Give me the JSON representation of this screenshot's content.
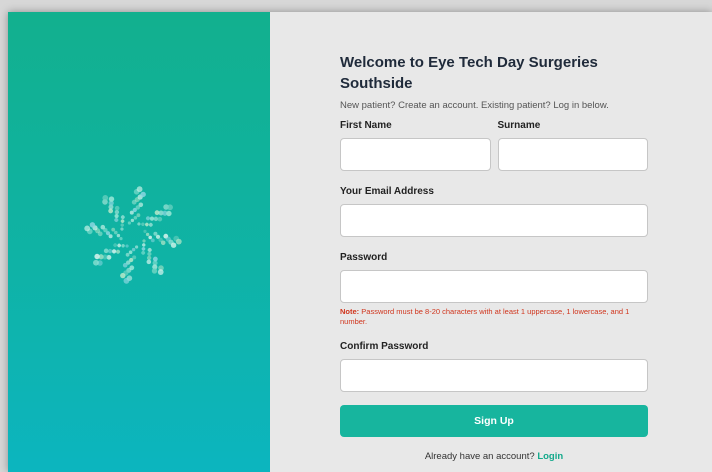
{
  "brand": {
    "logo_icon": "starburst-logo-icon",
    "accent": "#17b59e",
    "note_color": "#d0351d"
  },
  "form": {
    "title": "Welcome to Eye Tech Day Surgeries Southside",
    "subtitle": "New patient? Create an account. Existing patient? Log in below.",
    "first_name": {
      "label": "First Name",
      "value": ""
    },
    "surname": {
      "label": "Surname",
      "value": ""
    },
    "email": {
      "label": "Your Email Address",
      "value": ""
    },
    "password": {
      "label": "Password",
      "value": ""
    },
    "note_prefix": "Note:",
    "note_text": "Password must be 8-20 characters with at least 1 uppercase, 1 lowercase, and 1 number.",
    "confirm_password": {
      "label": "Confirm Password",
      "value": ""
    },
    "signup_label": "Sign Up",
    "login_prompt": "Already have an account?",
    "login_link": "Login"
  }
}
